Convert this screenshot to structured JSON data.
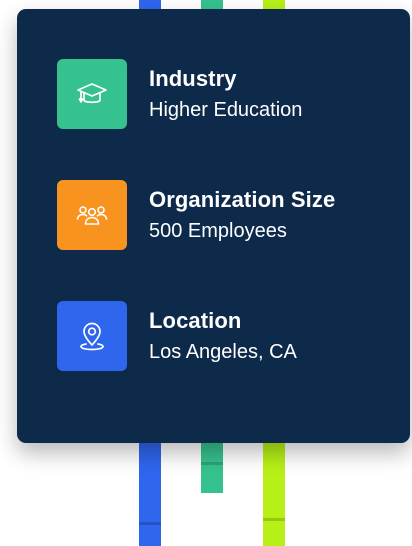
{
  "colors": {
    "card_bg": "#0E2A4A",
    "industry_icon_bg": "#36C28E",
    "size_icon_bg": "#F7931E",
    "location_icon_bg": "#2F66EE",
    "bar_blue": "#2F66EE",
    "bar_green": "#36C28E",
    "bar_lime": "#B7F017"
  },
  "profile": {
    "industry": {
      "icon": "graduation-cap-icon",
      "label": "Industry",
      "value": "Higher Education"
    },
    "organization_size": {
      "icon": "people-group-icon",
      "label": "Organization Size",
      "value": "500 Employees"
    },
    "location": {
      "icon": "location-pin-icon",
      "label": "Location",
      "value": "Los Angeles, CA"
    }
  }
}
